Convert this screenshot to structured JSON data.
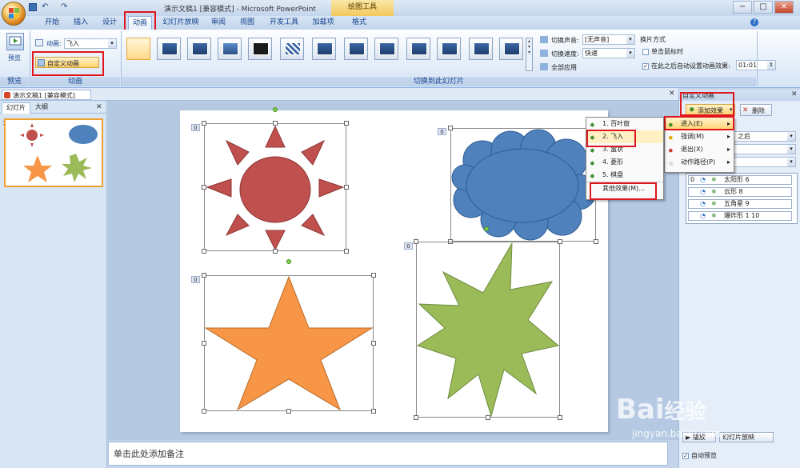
{
  "titlebar": {
    "title": "演示文稿1 [兼容模式] - Microsoft PowerPoint",
    "context_tab": "绘图工具",
    "win_min": "−",
    "win_max": "□",
    "win_close": "✕"
  },
  "tabs": [
    "开始",
    "插入",
    "设计",
    "动画",
    "幻灯片放映",
    "审阅",
    "视图",
    "开发工具",
    "加载项",
    "格式"
  ],
  "active_tab": "动画",
  "ribbon": {
    "preview_label": "预览",
    "preview_group": "预览",
    "anim_label": "动画:",
    "anim_value": "飞入",
    "custom_anim_button": "自定义动画",
    "anim_group": "动画",
    "transition_group": "切换到此幻灯片",
    "sound_label": "切换声音:",
    "sound_value": "[无声音]",
    "speed_label": "切换速度:",
    "speed_value": "快速",
    "apply_all": "全部应用",
    "advance_title": "换片方式",
    "on_click": "单击鼠标时",
    "auto_after": "在此之后自动设置动画效果:",
    "auto_time": "01:01"
  },
  "doc": {
    "tab_title": "演示文稿1 [兼容模式]",
    "close": "✕"
  },
  "leftpane": {
    "tab_slides": "幻灯片",
    "tab_outline": "大纲",
    "close": "✕",
    "slide_number": "1"
  },
  "notes": {
    "placeholder": "单击此处添加备注"
  },
  "slide": {
    "badge": "0"
  },
  "rightpane": {
    "title": "自定义动画",
    "close": "✕",
    "add_effect": "添加效果",
    "remove": "删除",
    "dropdown_tail": "之后",
    "list": [
      {
        "num": "0",
        "name": "太阳形 6"
      },
      {
        "num": "",
        "name": "云形 8"
      },
      {
        "num": "",
        "name": "五角星 9"
      },
      {
        "num": "",
        "name": "爆炸形 1 10"
      }
    ],
    "play": "播放",
    "slideshow": "幻灯片放映",
    "autopreview": "自动预览"
  },
  "submenu": {
    "items": [
      {
        "label": "进入(E)",
        "arrow": "▸"
      },
      {
        "label": "强调(M)",
        "arrow": "▸"
      },
      {
        "label": "退出(X)",
        "arrow": "▸"
      },
      {
        "label": "动作路径(P)",
        "arrow": "▸"
      }
    ]
  },
  "entermenu": {
    "items": [
      "1. 百叶窗",
      "2. 飞入",
      "3. 盒状",
      "4. 菱形",
      "5. 棋盘"
    ],
    "more": "其他效果(M)..."
  },
  "watermark": {
    "brand": "Bai",
    "brand2": "经验",
    "url": "jingyan.baidu.com"
  },
  "colors": {
    "sun": "#c0504d",
    "cloud": "#4f81bd",
    "star": "#f79646",
    "burst": "#9bbb59",
    "highlight": "#e0161e"
  }
}
